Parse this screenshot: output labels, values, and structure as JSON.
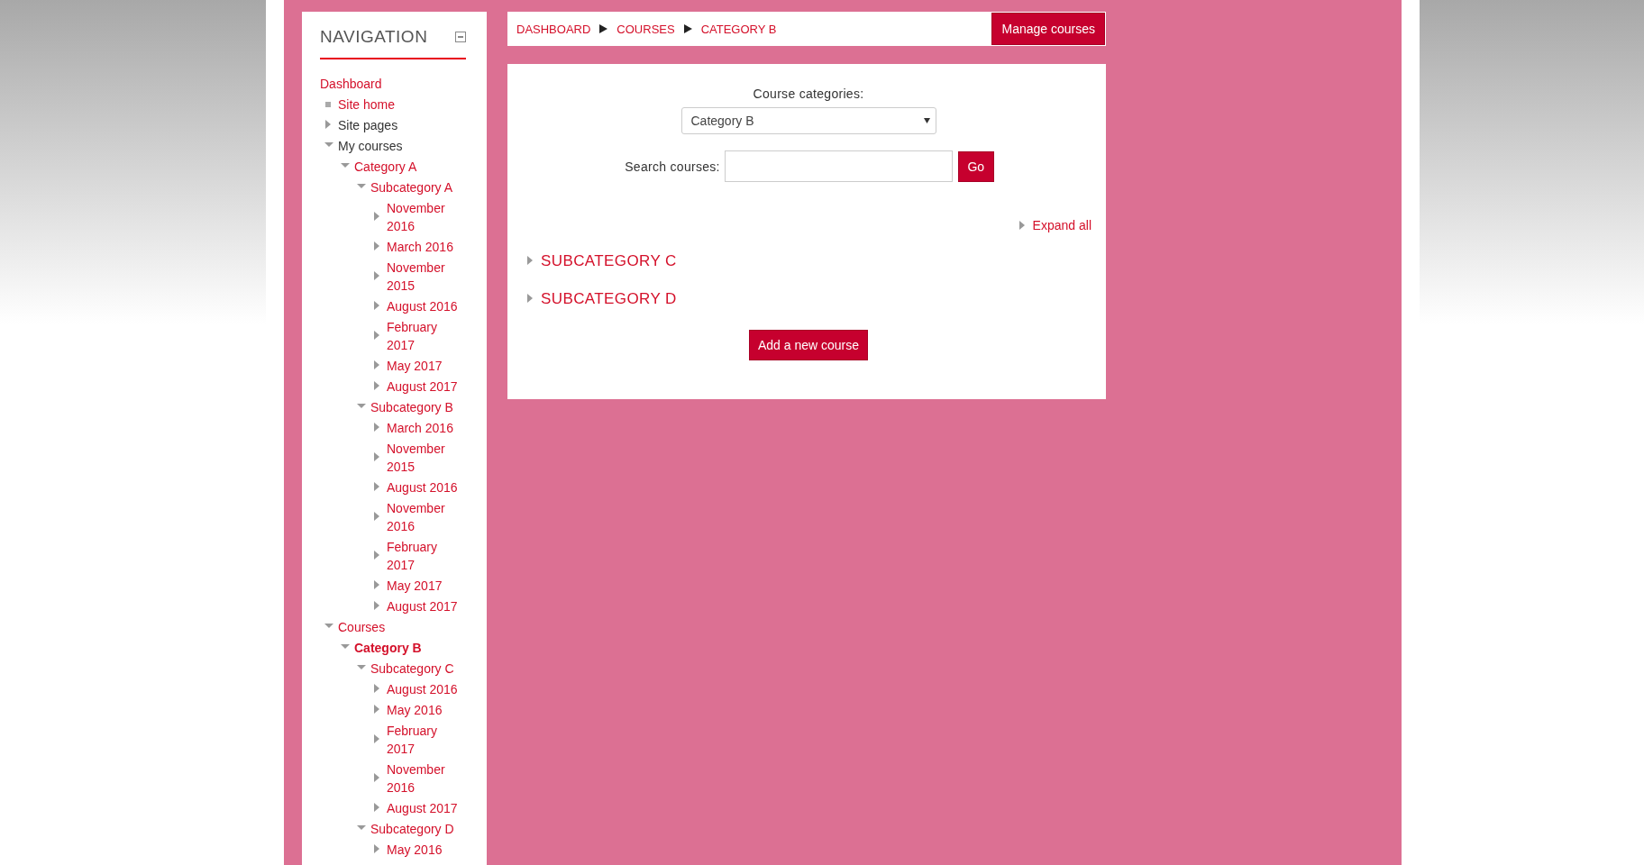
{
  "navigation": {
    "title": "NAVIGATION",
    "items": [
      {
        "label": "Dashboard",
        "kind": "root",
        "link": true,
        "selected": false,
        "children": [
          {
            "label": "Site home",
            "kind": "leaf",
            "link": true,
            "selected": false
          },
          {
            "label": "Site pages",
            "kind": "branch",
            "link": false,
            "selected": false,
            "expanded": false
          },
          {
            "label": "My courses",
            "kind": "branch",
            "link": false,
            "selected": false,
            "expanded": true,
            "children": [
              {
                "label": "Category A",
                "kind": "branch",
                "link": true,
                "selected": false,
                "expanded": true,
                "children": [
                  {
                    "label": "Subcategory A",
                    "kind": "branch",
                    "link": true,
                    "selected": false,
                    "expanded": true,
                    "children": [
                      {
                        "label": "November 2016",
                        "kind": "branch",
                        "link": true,
                        "selected": false,
                        "expanded": false
                      },
                      {
                        "label": "March 2016",
                        "kind": "branch",
                        "link": true,
                        "selected": false,
                        "expanded": false
                      },
                      {
                        "label": "November 2015",
                        "kind": "branch",
                        "link": true,
                        "selected": false,
                        "expanded": false
                      },
                      {
                        "label": "August 2016",
                        "kind": "branch",
                        "link": true,
                        "selected": false,
                        "expanded": false
                      },
                      {
                        "label": "February 2017",
                        "kind": "branch",
                        "link": true,
                        "selected": false,
                        "expanded": false
                      },
                      {
                        "label": "May 2017",
                        "kind": "branch",
                        "link": true,
                        "selected": false,
                        "expanded": false
                      },
                      {
                        "label": "August 2017",
                        "kind": "branch",
                        "link": true,
                        "selected": false,
                        "expanded": false
                      }
                    ]
                  },
                  {
                    "label": "Subcategory B",
                    "kind": "branch",
                    "link": true,
                    "selected": false,
                    "expanded": true,
                    "children": [
                      {
                        "label": "March 2016",
                        "kind": "branch",
                        "link": true,
                        "selected": false,
                        "expanded": false
                      },
                      {
                        "label": "November 2015",
                        "kind": "branch",
                        "link": true,
                        "selected": false,
                        "expanded": false
                      },
                      {
                        "label": "August 2016",
                        "kind": "branch",
                        "link": true,
                        "selected": false,
                        "expanded": false
                      },
                      {
                        "label": "November 2016",
                        "kind": "branch",
                        "link": true,
                        "selected": false,
                        "expanded": false
                      },
                      {
                        "label": "February 2017",
                        "kind": "branch",
                        "link": true,
                        "selected": false,
                        "expanded": false
                      },
                      {
                        "label": "May 2017",
                        "kind": "branch",
                        "link": true,
                        "selected": false,
                        "expanded": false
                      },
                      {
                        "label": "August 2017",
                        "kind": "branch",
                        "link": true,
                        "selected": false,
                        "expanded": false
                      }
                    ]
                  }
                ]
              }
            ]
          },
          {
            "label": "Courses",
            "kind": "branch",
            "link": true,
            "selected": false,
            "expanded": true,
            "children": [
              {
                "label": "Category B",
                "kind": "branch",
                "link": true,
                "selected": true,
                "expanded": true,
                "children": [
                  {
                    "label": "Subcategory C",
                    "kind": "branch",
                    "link": true,
                    "selected": false,
                    "expanded": true,
                    "children": [
                      {
                        "label": "August 2016",
                        "kind": "branch",
                        "link": true,
                        "selected": false,
                        "expanded": false
                      },
                      {
                        "label": "May 2016",
                        "kind": "branch",
                        "link": true,
                        "selected": false,
                        "expanded": false
                      },
                      {
                        "label": "February 2017",
                        "kind": "branch",
                        "link": true,
                        "selected": false,
                        "expanded": false
                      },
                      {
                        "label": "November 2016",
                        "kind": "branch",
                        "link": true,
                        "selected": false,
                        "expanded": false
                      },
                      {
                        "label": "August 2017",
                        "kind": "branch",
                        "link": true,
                        "selected": false,
                        "expanded": false
                      }
                    ]
                  },
                  {
                    "label": "Subcategory D",
                    "kind": "branch",
                    "link": true,
                    "selected": false,
                    "expanded": true,
                    "children": [
                      {
                        "label": "May 2016",
                        "kind": "branch",
                        "link": true,
                        "selected": false,
                        "expanded": false
                      }
                    ]
                  }
                ]
              }
            ]
          }
        ]
      }
    ]
  },
  "breadcrumb": [
    "DASHBOARD",
    "COURSES",
    "CATEGORY B"
  ],
  "manage_button": "Manage courses",
  "content": {
    "categories_label": "Course categories:",
    "category_select": "Category B",
    "search_label": "Search courses:",
    "go_button": "Go",
    "expand_all": "Expand all",
    "categories": [
      {
        "label": "SUBCATEGORY C",
        "expanded": false
      },
      {
        "label": "SUBCATEGORY D",
        "expanded": false
      }
    ],
    "add_button": "Add a new course"
  }
}
